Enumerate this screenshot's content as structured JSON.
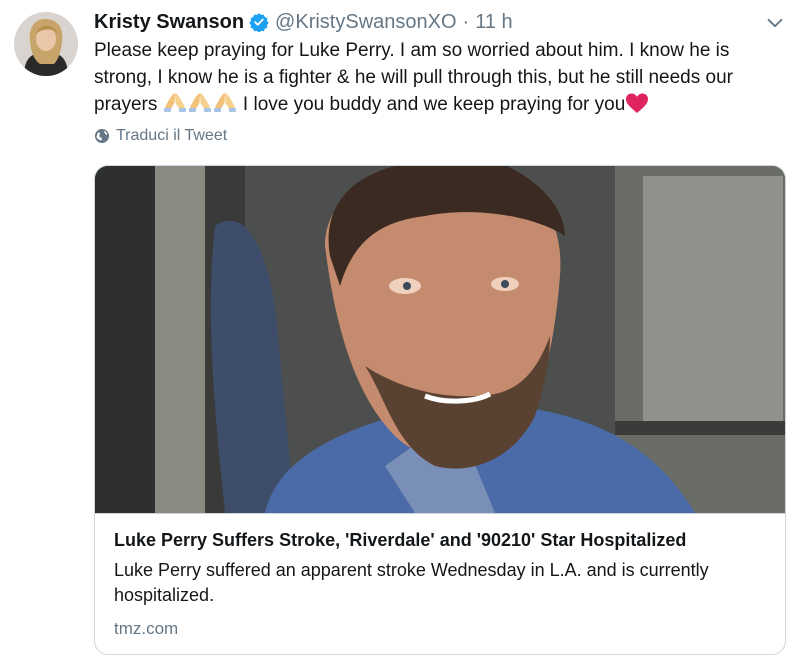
{
  "tweet": {
    "author": {
      "display_name": "Kristy Swanson",
      "verified": true,
      "handle": "@KristySwansonXO",
      "separator": "·",
      "time": "11 h"
    },
    "text_part1": "Please keep praying for Luke Perry. I am so worried about him. I know he is strong, I know he is a fighter & he will pull through this, but he still needs our prayers",
    "text_part2": " I love you buddy and we keep praying for you",
    "emojis": [
      "folded-hands",
      "folded-hands",
      "folded-hands",
      "red-heart"
    ],
    "translate_label": "Traduci il Tweet"
  },
  "card": {
    "title": "Luke Perry Suffers Stroke, 'Riverdale' and '90210' Star Hospitalized",
    "description": "Luke Perry suffered an apparent stroke Wednesday in L.A. and is currently hospitalized.",
    "domain": "tmz.com"
  },
  "colors": {
    "text": "#14171a",
    "secondary": "#657786",
    "verified_blue": "#1da1f2",
    "heart_red": "#e0245e",
    "card_border": "#ccd6dd"
  },
  "icons": [
    "verified-badge-icon",
    "chevron-down-icon",
    "globe-icon"
  ]
}
